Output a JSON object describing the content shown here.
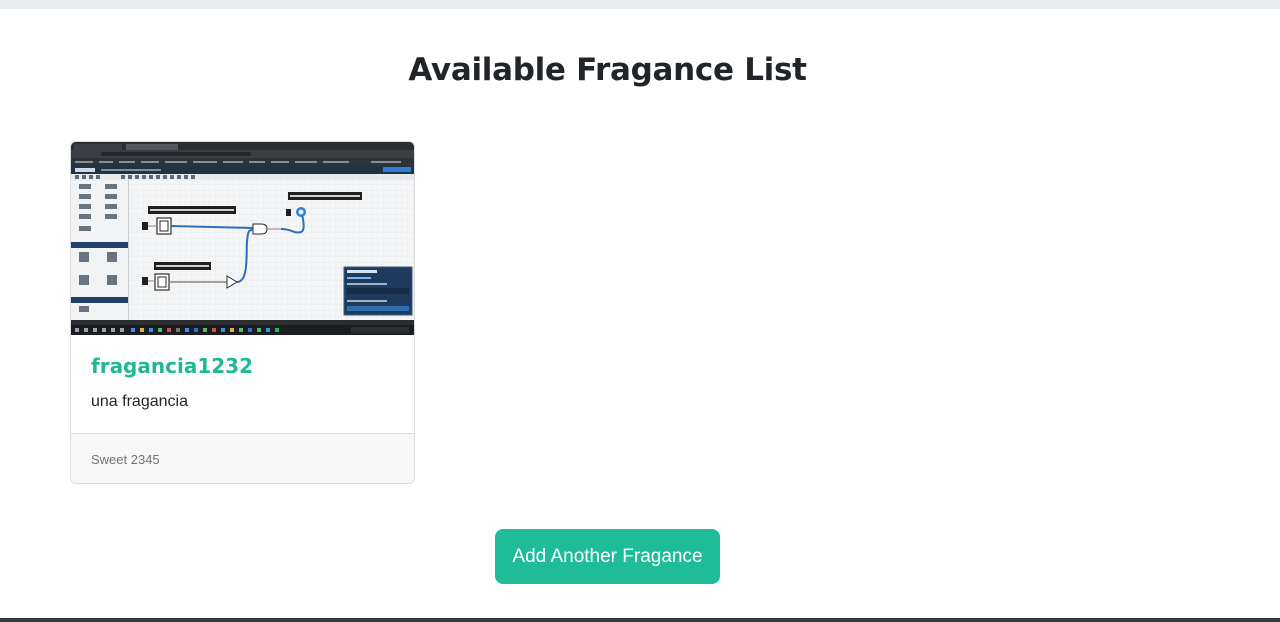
{
  "page": {
    "title": "Available Fragance List"
  },
  "cards": [
    {
      "name": "fragancia1232",
      "description": "una fragancia",
      "footer": "Sweet 2345",
      "image": {
        "alt": "logic.ly circuit screenshot",
        "labels": {
          "top": "Doña Florinda le paga a don ramon",
          "upper": "Don ramon sea pendiente de los chavos",
          "lower": "Chavo se come las charros",
          "panel_title": "logic.ly"
        }
      }
    }
  ],
  "actions": {
    "add_label": "Add Another Fragance"
  },
  "colors": {
    "accent": "#1fbc9a",
    "title": "#212529",
    "footer_bg": "#f7f7f7"
  }
}
